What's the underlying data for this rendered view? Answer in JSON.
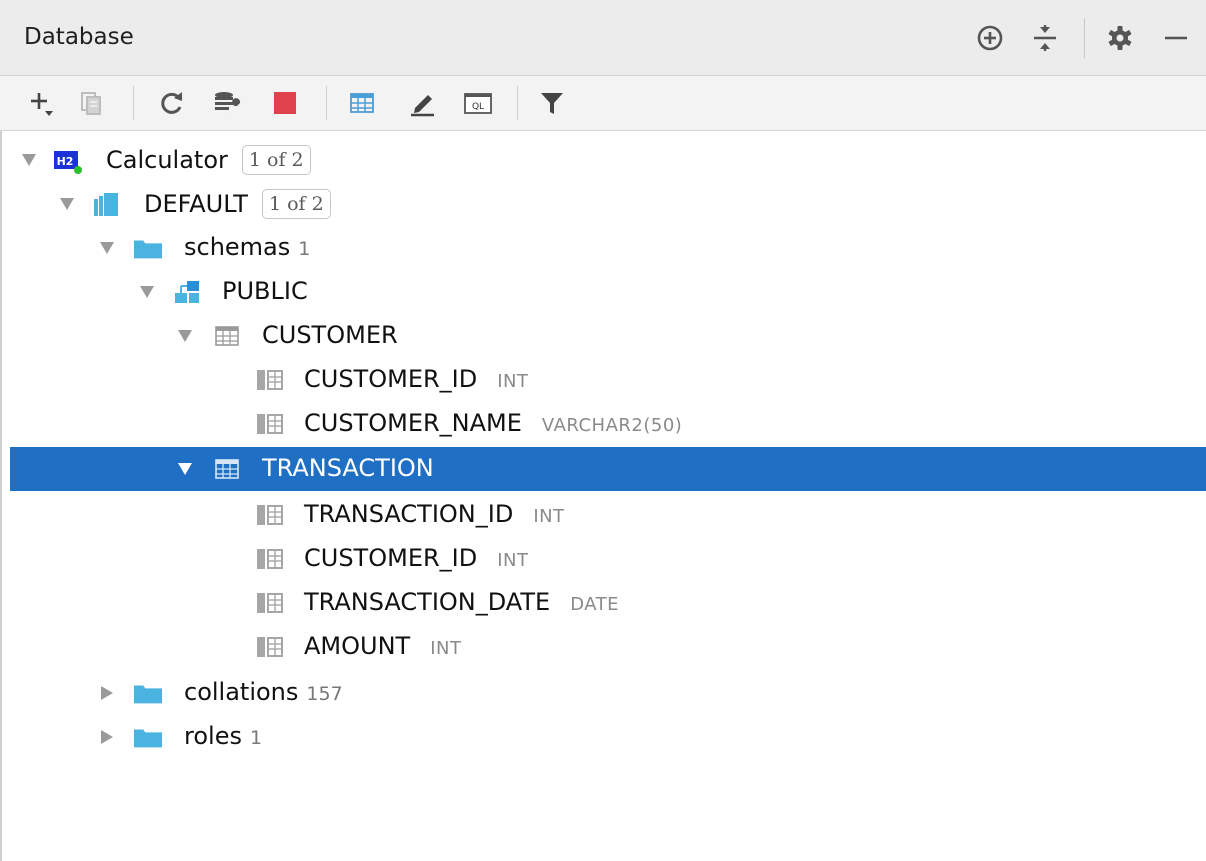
{
  "header": {
    "title": "Database",
    "icons": [
      "add-target-icon",
      "collapse-all-icon",
      "settings-gear-icon",
      "minimize-icon"
    ]
  },
  "toolbar": {
    "icons": [
      "add-icon",
      "duplicate-icon",
      "refresh-icon",
      "data-source-properties-icon",
      "stop-icon",
      "table-view-icon",
      "edit-icon",
      "query-console-icon",
      "filter-icon"
    ]
  },
  "colors": {
    "selection": "#1f6fc5",
    "folder": "#4bb3e0",
    "stop": "#e0424d",
    "h2_badge": "#1a32d8"
  },
  "tree": {
    "calculator": {
      "label": "Calculator",
      "badge": "1 of 2"
    },
    "default": {
      "label": "DEFAULT",
      "badge": "1 of 2"
    },
    "schemas": {
      "label": "schemas",
      "count": "1"
    },
    "public": {
      "label": "PUBLIC"
    },
    "customer": {
      "label": "CUSTOMER",
      "columns": [
        {
          "name": "CUSTOMER_ID",
          "type": "INT"
        },
        {
          "name": "CUSTOMER_NAME",
          "type": "VARCHAR2(50)"
        }
      ]
    },
    "transaction": {
      "label": "TRANSACTION",
      "columns": [
        {
          "name": "TRANSACTION_ID",
          "type": "INT"
        },
        {
          "name": "CUSTOMER_ID",
          "type": "INT"
        },
        {
          "name": "TRANSACTION_DATE",
          "type": "DATE"
        },
        {
          "name": "AMOUNT",
          "type": "INT"
        }
      ]
    },
    "collations": {
      "label": "collations",
      "count": "157"
    },
    "roles": {
      "label": "roles",
      "count": "1"
    }
  }
}
